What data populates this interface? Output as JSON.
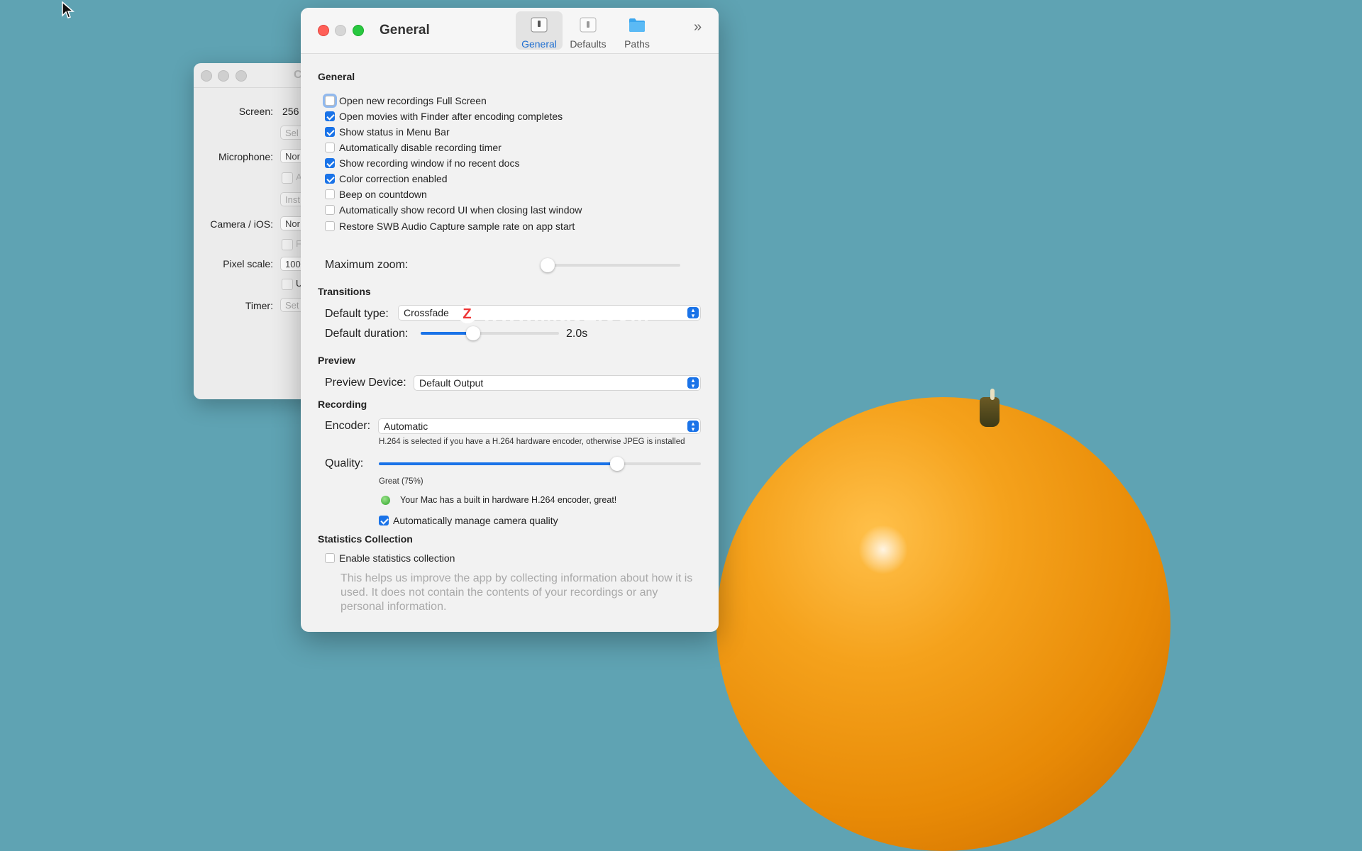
{
  "background_window": {
    "title_fragment": "C",
    "labels": {
      "screen": "Screen:",
      "microphone": "Microphone:",
      "camera": "Camera / iOS:",
      "pixel_scale": "Pixel scale:",
      "timer": "Timer:"
    },
    "values": {
      "screen": "256",
      "select_button": "Sel",
      "microphone": "Nor",
      "mic_checkbox_text": "A",
      "install_button": "Inst",
      "camera": "Nor",
      "camera_checkbox_text": "F",
      "pixel_scale": "100",
      "pixel_checkbox_text": "U",
      "timer": "Set"
    }
  },
  "window": {
    "title": "General",
    "tabs": [
      {
        "label": "General",
        "icon": "switch-icon",
        "active": true
      },
      {
        "label": "Defaults",
        "icon": "switch-icon",
        "active": false
      },
      {
        "label": "Paths",
        "icon": "folder-icon",
        "active": false
      }
    ],
    "more_icon": "chevron-double-right-icon"
  },
  "general": {
    "heading": "General",
    "options": [
      {
        "label": "Open new recordings Full Screen",
        "checked": false
      },
      {
        "label": "Open movies with Finder after encoding completes",
        "checked": true
      },
      {
        "label": "Show status in Menu Bar",
        "checked": true
      },
      {
        "label": "Automatically disable recording timer",
        "checked": false
      },
      {
        "label": "Show recording window if no recent docs",
        "checked": true
      },
      {
        "label": "Color correction enabled",
        "checked": true
      },
      {
        "label": "Beep on countdown",
        "checked": false
      },
      {
        "label": "Automatically show record UI when closing last window",
        "checked": false
      },
      {
        "label": "Restore SWB Audio Capture sample rate on app start",
        "checked": false
      }
    ],
    "max_zoom_label": "Maximum zoom:",
    "max_zoom_level": 0
  },
  "transitions": {
    "heading": "Transitions",
    "type_label": "Default type:",
    "type_value": "Crossfade",
    "duration_label": "Default duration:",
    "duration_value": "2.0s",
    "duration_level": 0.38
  },
  "preview": {
    "heading": "Preview",
    "device_label": "Preview Device:",
    "device_value": "Default Output"
  },
  "recording": {
    "heading": "Recording",
    "encoder_label": "Encoder:",
    "encoder_value": "Automatic",
    "encoder_hint": "H.264 is selected if you have a H.264 hardware encoder, otherwise JPEG is installed",
    "quality_label": "Quality:",
    "quality_level": 0.74,
    "quality_text": "Great (75%)",
    "hardware_status": "Your Mac has a built in hardware H.264 encoder, great!",
    "auto_camera_label": "Automatically manage camera quality",
    "auto_camera_checked": true
  },
  "statistics": {
    "heading": "Statistics Collection",
    "enable_label": "Enable statistics collection",
    "enable_checked": false,
    "description": "This helps us improve the app by collecting information about how it is used. It does not contain the contents of your recordings or any personal information."
  },
  "watermark": {
    "text": "www.MacZ.com",
    "badge": "Z"
  },
  "colors": {
    "accent": "#1a73e8",
    "desktop": "#5fa3b3",
    "close": "#ff5f57",
    "zoom": "#28c840"
  }
}
